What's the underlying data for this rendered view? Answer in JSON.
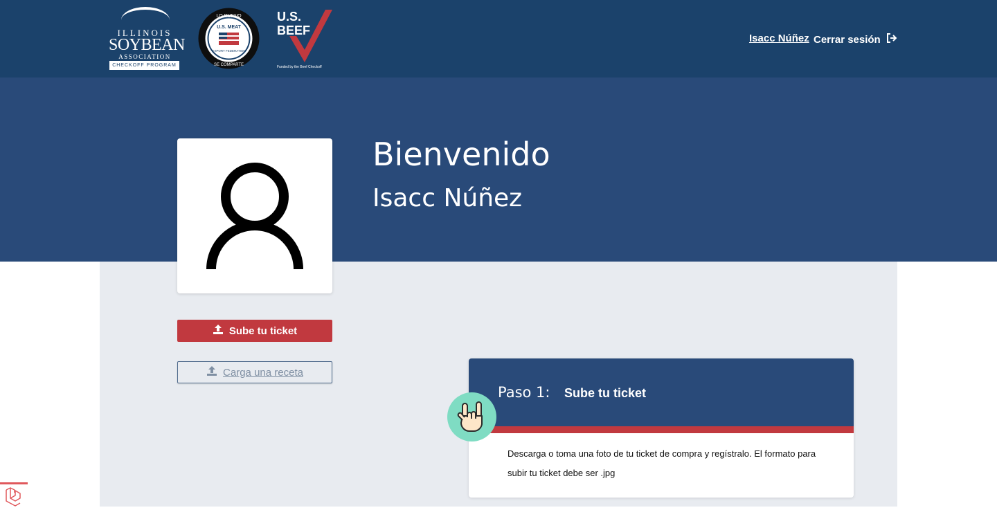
{
  "header": {
    "logos": {
      "soybean": {
        "line1": "ILLINOIS",
        "line2": "SOYBEAN",
        "line3": "ASSOCIATION",
        "line4": "CHECKOFF PROGRAM"
      },
      "usmef": {
        "top_text": "LO BUENO",
        "brand": "U.S. MEAT",
        "sub": "EXPORT FEDERATION",
        "bottom_text": "SE COMPARTE"
      },
      "beef": {
        "brand_line1": "U.S.",
        "brand_line2": "BEEF",
        "tagline": "Funded by the Beef Checkoff"
      }
    },
    "nav": {
      "user_link": "Isacc Núñez",
      "logout_label": "Cerrar sesión"
    }
  },
  "hero": {
    "welcome": "Bienvenido",
    "user_name": "Isacc Núñez"
  },
  "actions": {
    "upload_ticket": "Sube tu ticket",
    "upload_recipe": "Carga una receta"
  },
  "step": {
    "number_label": "Paso 1:",
    "title": "Sube tu ticket",
    "description": "Descarga o toma una foto de tu ticket de compra y regístralo. El formato para subir tu ticket debe ser .jpg"
  },
  "icons": {
    "avatar": "user-silhouette-icon",
    "upload": "upload-icon",
    "logout": "logout-icon",
    "hand": "hand-gesture-icon",
    "framework": "laravel-icon"
  },
  "colors": {
    "topbar": "#1b426b",
    "hero": "#294a79",
    "accent_red": "#c1393f",
    "content_bg": "#e8ebf0",
    "badge_green": "#7fdcc3"
  }
}
